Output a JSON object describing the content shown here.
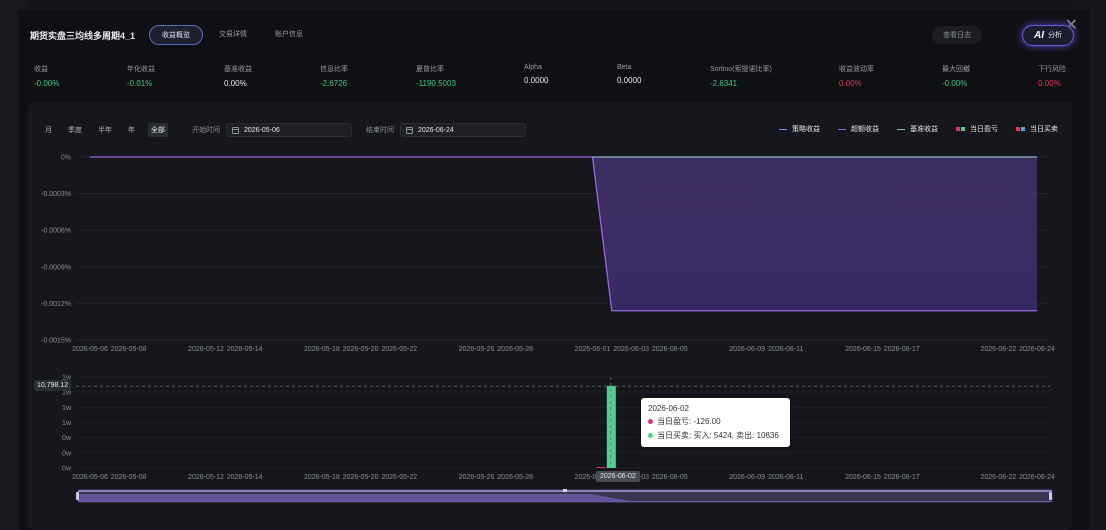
{
  "header": {
    "title": "期货实盘三均线多周期4_1",
    "tabs": [
      {
        "label": "收益概览",
        "active": true
      },
      {
        "label": "交易详情",
        "active": false
      },
      {
        "label": "账户信息",
        "active": false
      }
    ],
    "log_button": "查看日志",
    "ai_mark": "AI",
    "ai_label": "分析",
    "close_icon": "close-icon"
  },
  "metrics": [
    {
      "label": "收益",
      "value": "-0.00%",
      "color": "green"
    },
    {
      "label": "年化收益",
      "value": "-0.01%",
      "color": "green"
    },
    {
      "label": "基准收益",
      "value": "0.00%",
      "color": "white"
    },
    {
      "label": "信息比率",
      "value": "-2.6726",
      "color": "green"
    },
    {
      "label": "夏普比率",
      "value": "-1190.5003",
      "color": "green"
    },
    {
      "label": "Alpha",
      "value": "0.0000",
      "color": "white"
    },
    {
      "label": "Beta",
      "value": "0.0000",
      "color": "white"
    },
    {
      "label": "Sortino(索提诺比率)",
      "value": "-2.6341",
      "color": "green"
    },
    {
      "label": "收益波动率",
      "value": "0.00%",
      "color": "red"
    },
    {
      "label": "最大回撤",
      "value": "-0.00%",
      "color": "green"
    },
    {
      "label": "下行风险",
      "value": "0.00%",
      "color": "red"
    }
  ],
  "controls": {
    "periods": [
      {
        "label": "月",
        "active": false
      },
      {
        "label": "季度",
        "active": false
      },
      {
        "label": "半年",
        "active": false
      },
      {
        "label": "年",
        "active": false
      },
      {
        "label": "全部",
        "active": true
      }
    ],
    "start_label": "开始时间",
    "start_value": "2026-05-06",
    "end_label": "结束时间",
    "end_value": "2026-06-24"
  },
  "legend": [
    {
      "label": "策略收益",
      "kind": "line",
      "colors": [
        "#6f9be0"
      ]
    },
    {
      "label": "超额收益",
      "kind": "line",
      "colors": [
        "#9a66e0"
      ]
    },
    {
      "label": "基准收益",
      "kind": "line",
      "colors": [
        "#8fb5c8"
      ]
    },
    {
      "label": "当日盈亏",
      "kind": "squares",
      "colors": [
        "#e0355f",
        "#4dd08e"
      ]
    },
    {
      "label": "当日买卖",
      "kind": "squares",
      "colors": [
        "#e0355f",
        "#5ea0e0"
      ]
    }
  ],
  "chart_data": [
    {
      "type": "area",
      "x": [
        "2026-05-06",
        "2026-05-08",
        "2026-05-12",
        "2026-05-14",
        "2026-05-18",
        "2026-05-20",
        "2026-05-22",
        "2026-05-26",
        "2026-05-28",
        "2026-06-01",
        "2026-06-03",
        "2026-06-05",
        "2026-06-09",
        "2026-06-11",
        "2026-06-15",
        "2026-06-17",
        "2026-06-22",
        "2026-06-24"
      ],
      "y_ticks": [
        "0%",
        "-0.0003%",
        "-0.0006%",
        "-0.0009%",
        "-0.0012%",
        "-0.0015%"
      ],
      "ylim": [
        -0.0015,
        0
      ],
      "series": [
        {
          "name": "超额收益",
          "color": "#9a66e0",
          "points": [
            [
              "2026-05-06",
              0
            ],
            [
              "2026-06-01",
              0
            ],
            [
              "2026-06-02",
              -0.00126
            ],
            [
              "2026-06-24",
              -0.00126
            ]
          ]
        },
        {
          "name": "基准收益",
          "color": "#8fb5c8",
          "points": [
            [
              "2026-06-01",
              0
            ],
            [
              "2026-06-24",
              0
            ]
          ]
        }
      ]
    },
    {
      "type": "bar",
      "x": [
        "2026-05-06",
        "2026-05-08",
        "2026-05-12",
        "2026-05-14",
        "2026-05-18",
        "2026-05-20",
        "2026-05-22",
        "2026-05-26",
        "2026-05-28",
        "2026-06-01",
        "2026-06-03",
        "2026-06-05",
        "2026-06-09",
        "2026-06-11",
        "2026-06-15",
        "2026-06-17",
        "2026-06-22",
        "2026-06-24"
      ],
      "y_ticks": [
        "1w",
        "1w",
        "1w",
        "1w",
        "0w",
        "0w",
        "0w"
      ],
      "ylim": [
        0,
        12000
      ],
      "series": [
        {
          "name": "当日盈亏",
          "color": "#e0355f",
          "points": [
            [
              "2026-06-02",
              -126.0
            ]
          ]
        },
        {
          "name": "当日买卖",
          "color": "#4dd08e",
          "points": [
            [
              "2026-06-02",
              10836
            ]
          ]
        }
      ],
      "axis_pointer_value": "10,798.12",
      "axis_pointer_date": "2026-06-02"
    }
  ],
  "tooltip": {
    "date": "2026-06-02",
    "pnl_text": "当日盈亏: -126.00",
    "trade_text": "当日买卖: 买入: 5424, 卖出: 10836"
  }
}
